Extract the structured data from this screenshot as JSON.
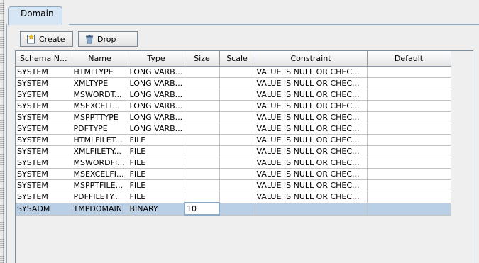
{
  "tabs": [
    {
      "label": "Domain"
    }
  ],
  "toolbar": {
    "create_label": "Create",
    "drop_label": "Drop"
  },
  "table": {
    "columns": [
      "Schema N...",
      "Name",
      "Type",
      "Size",
      "Scale",
      "Constraint",
      "Default"
    ],
    "rows": [
      [
        "SYSTEM",
        "HTMLTYPE",
        "LONG VARB...",
        "",
        "",
        "VALUE IS NULL OR CHEC...",
        ""
      ],
      [
        "SYSTEM",
        "XMLTYPE",
        "LONG VARB...",
        "",
        "",
        "VALUE IS NULL OR CHEC...",
        ""
      ],
      [
        "SYSTEM",
        "MSWORDT...",
        "LONG VARB...",
        "",
        "",
        "VALUE IS NULL OR CHEC...",
        ""
      ],
      [
        "SYSTEM",
        "MSEXCELT...",
        "LONG VARB...",
        "",
        "",
        "VALUE IS NULL OR CHEC...",
        ""
      ],
      [
        "SYSTEM",
        "MSPPTTYPE",
        "LONG VARB...",
        "",
        "",
        "VALUE IS NULL OR CHEC...",
        ""
      ],
      [
        "SYSTEM",
        "PDFTYPE",
        "LONG VARB...",
        "",
        "",
        "VALUE IS NULL OR CHEC...",
        ""
      ],
      [
        "SYSTEM",
        "HTMLFILET...",
        "FILE",
        "",
        "",
        "VALUE IS NULL OR CHEC...",
        ""
      ],
      [
        "SYSTEM",
        "XMLFILETY...",
        "FILE",
        "",
        "",
        "VALUE IS NULL OR CHEC...",
        ""
      ],
      [
        "SYSTEM",
        "MSWORDFI...",
        "FILE",
        "",
        "",
        "VALUE IS NULL OR CHEC...",
        ""
      ],
      [
        "SYSTEM",
        "MSEXCELFI...",
        "FILE",
        "",
        "",
        "VALUE IS NULL OR CHEC...",
        ""
      ],
      [
        "SYSTEM",
        "MSPPTFILE...",
        "FILE",
        "",
        "",
        "VALUE IS NULL OR CHEC...",
        ""
      ],
      [
        "SYSTEM",
        "PDFFILETY...",
        "FILE",
        "",
        "",
        "VALUE IS NULL OR CHEC...",
        ""
      ],
      [
        "SYSADM",
        "TMPDOMAIN",
        "BINARY",
        "10",
        "",
        "",
        ""
      ]
    ],
    "selected_row": 12,
    "editing_column": 3
  },
  "colors": {
    "selection": "#b9cfe6",
    "tab": "#d6e6f5",
    "border": "#8da8c3"
  }
}
